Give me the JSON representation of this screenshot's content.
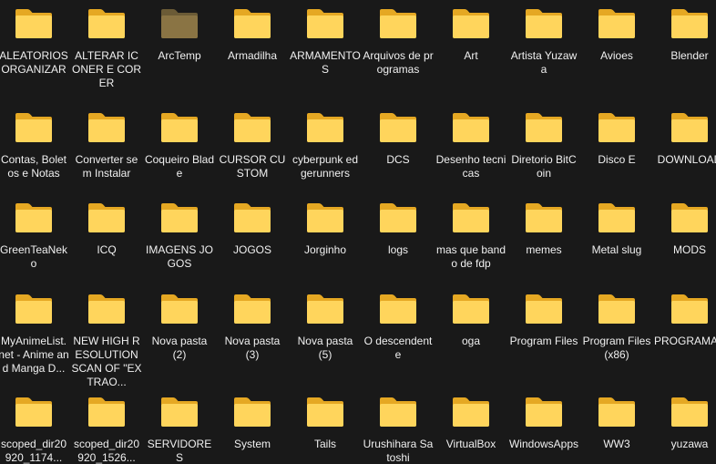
{
  "explorer": {
    "view": "large-icons",
    "colors": {
      "background": "#191919",
      "folder_back": "#e5a823",
      "folder_front": "#ffd55c",
      "folder_dim_back": "#6b5b36",
      "folder_dim_front": "#8a7444",
      "text": "#f0f0f0"
    },
    "folders": [
      {
        "label": "ALEATORIOS ORGANIZAR",
        "icon": "folder-icon"
      },
      {
        "label": "ALTERAR ICONER E CORER",
        "icon": "folder-icon"
      },
      {
        "label": "ArcTemp",
        "icon": "folder-hidden-icon"
      },
      {
        "label": "Armadilha",
        "icon": "folder-icon"
      },
      {
        "label": "ARMAMENTOS",
        "icon": "folder-icon"
      },
      {
        "label": "Arquivos de programas",
        "icon": "folder-icon"
      },
      {
        "label": "Art",
        "icon": "folder-icon"
      },
      {
        "label": "Artista Yuzawa",
        "icon": "folder-icon"
      },
      {
        "label": "Avioes",
        "icon": "folder-icon"
      },
      {
        "label": "Blender",
        "icon": "folder-icon"
      },
      {
        "label": "Contas, Boletos e Notas",
        "icon": "folder-icon"
      },
      {
        "label": "Converter sem Instalar",
        "icon": "folder-icon"
      },
      {
        "label": "Coqueiro Blade",
        "icon": "folder-icon"
      },
      {
        "label": "CURSOR CUSTOM",
        "icon": "folder-icon"
      },
      {
        "label": "cyberpunk edgerunners",
        "icon": "folder-icon"
      },
      {
        "label": "DCS",
        "icon": "folder-icon"
      },
      {
        "label": "Desenho tecnicas",
        "icon": "folder-icon"
      },
      {
        "label": "Diretorio BitCoin",
        "icon": "folder-icon"
      },
      {
        "label": "Disco E",
        "icon": "folder-icon"
      },
      {
        "label": "DOWNLOAD",
        "icon": "folder-icon"
      },
      {
        "label": "GreenTeaNeko",
        "icon": "folder-icon"
      },
      {
        "label": "ICQ",
        "icon": "folder-icon"
      },
      {
        "label": "IMAGENS JOGOS",
        "icon": "folder-icon"
      },
      {
        "label": "JOGOS",
        "icon": "folder-icon"
      },
      {
        "label": "Jorginho",
        "icon": "folder-icon"
      },
      {
        "label": "logs",
        "icon": "folder-icon"
      },
      {
        "label": "mas que bando de fdp",
        "icon": "folder-icon"
      },
      {
        "label": "memes",
        "icon": "folder-icon"
      },
      {
        "label": "Metal slug",
        "icon": "folder-icon"
      },
      {
        "label": "MODS",
        "icon": "folder-icon"
      },
      {
        "label": "MyAnimeList.net - Anime and Manga D...",
        "icon": "folder-icon"
      },
      {
        "label": "NEW HIGH RESOLUTION SCAN OF \"EXTRAO...",
        "icon": "folder-icon"
      },
      {
        "label": "Nova pasta (2)",
        "icon": "folder-icon"
      },
      {
        "label": "Nova pasta (3)",
        "icon": "folder-icon"
      },
      {
        "label": "Nova pasta (5)",
        "icon": "folder-icon"
      },
      {
        "label": "O descendente",
        "icon": "folder-icon"
      },
      {
        "label": "oga",
        "icon": "folder-icon"
      },
      {
        "label": "Program Files",
        "icon": "folder-icon"
      },
      {
        "label": "Program Files (x86)",
        "icon": "folder-icon"
      },
      {
        "label": "PROGRAMAS",
        "icon": "folder-icon"
      },
      {
        "label": "scoped_dir20920_1174...",
        "icon": "folder-icon"
      },
      {
        "label": "scoped_dir20920_1526...",
        "icon": "folder-icon"
      },
      {
        "label": "SERVIDORES",
        "icon": "folder-icon"
      },
      {
        "label": "System",
        "icon": "folder-icon"
      },
      {
        "label": "Tails",
        "icon": "folder-icon"
      },
      {
        "label": "Urushihara Satoshi",
        "icon": "folder-icon"
      },
      {
        "label": "VirtualBox",
        "icon": "folder-icon"
      },
      {
        "label": "WindowsApps",
        "icon": "folder-icon"
      },
      {
        "label": "WW3",
        "icon": "folder-icon"
      },
      {
        "label": "yuzawa",
        "icon": "folder-icon"
      }
    ]
  }
}
